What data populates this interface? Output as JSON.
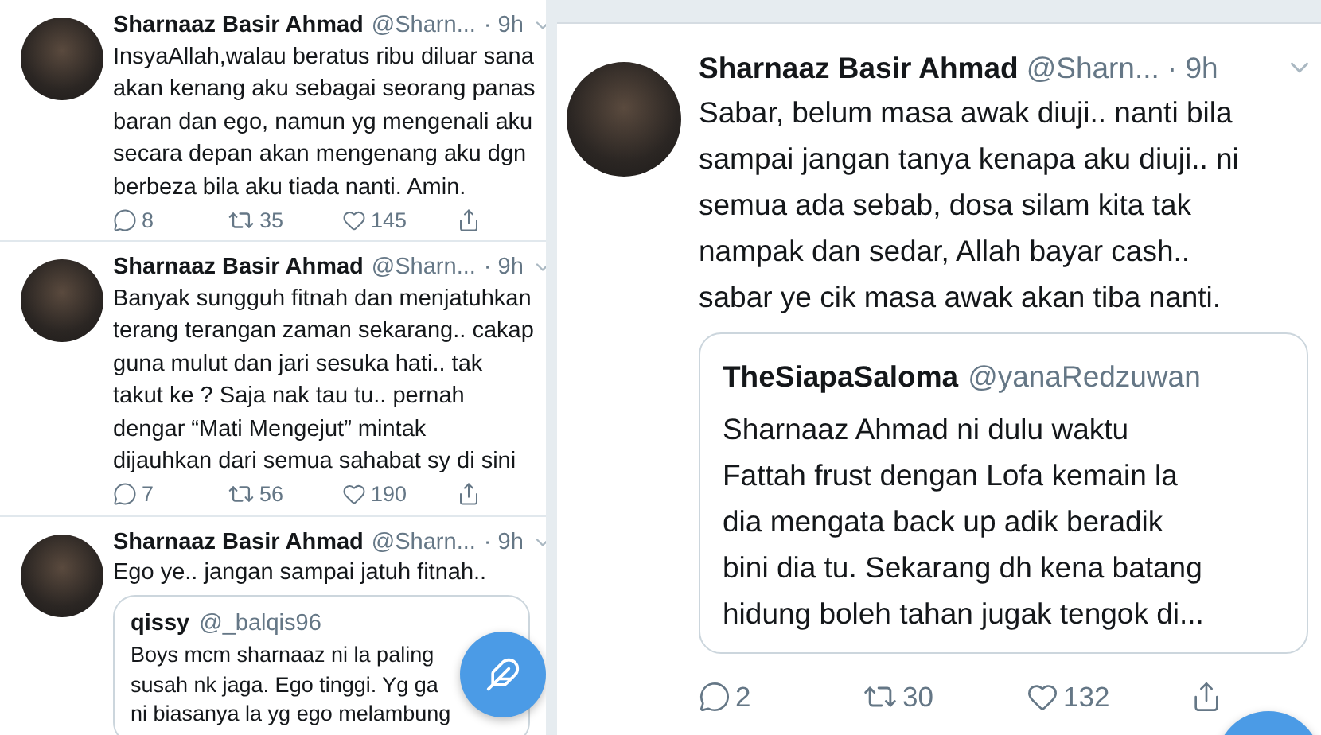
{
  "panels": [
    {
      "kind": "compact",
      "tweets": [
        {
          "name": "Sharnaaz Basir Ahmad",
          "handle": "@Sharn...",
          "time": "· 9h",
          "lines": [
            "InsyaAllah,walau beratus ribu diluar sana",
            "akan kenang aku sebagai seorang panas",
            "baran dan ego, namun yg mengenali aku",
            "secara depan akan mengenang aku dgn",
            "berbeza bila aku tiada nanti. Amin."
          ],
          "replies": "8",
          "retweets": "35",
          "likes": "145"
        },
        {
          "name": "Sharnaaz Basir Ahmad",
          "handle": "@Sharn...",
          "time": "· 9h",
          "lines": [
            "Banyak sungguh fitnah dan menjatuhkan",
            "terang terangan zaman sekarang.. cakap",
            "guna mulut dan jari sesuka hati.. tak",
            "takut ke ? Saja nak tau tu.. pernah",
            "dengar “Mati Mengejut” mintak",
            "dijauhkan dari semua sahabat sy di sini"
          ],
          "replies": "7",
          "retweets": "56",
          "likes": "190"
        },
        {
          "name": "Sharnaaz Basir Ahmad",
          "handle": "@Sharn...",
          "time": "· 9h",
          "lines": [
            "Ego ye.. jangan sampai jatuh fitnah.."
          ],
          "quote": {
            "name": "qissy",
            "handle": "@_balqis96",
            "lines": [
              "Boys mcm sharnaaz ni la paling",
              "susah nk jaga. Ego tinggi. Yg ga",
              "ni biasanya la yg ego melambung"
            ]
          }
        }
      ]
    },
    {
      "kind": "large",
      "tweets": [
        {
          "name": "Sharnaaz Basir Ahmad",
          "handle": "@Sharn...",
          "time": "· 9h",
          "lines": [
            "Sabar, belum masa awak diuji.. nanti bila",
            "sampai jangan tanya kenapa aku diuji.. ni",
            "semua ada sebab, dosa silam kita tak",
            "nampak dan sedar, Allah bayar cash..",
            "sabar ye cik masa awak akan tiba nanti."
          ],
          "quote": {
            "name": "TheSiapaSaloma",
            "handle": "@yanaRedzuwan",
            "lines": [
              "Sharnaaz Ahmad ni dulu waktu",
              "Fattah frust dengan Lofa kemain la",
              "dia mengata back up adik beradik",
              "bini dia tu. Sekarang dh kena batang",
              "hidung boleh tahan jugak tengok di..."
            ]
          },
          "replies": "2",
          "retweets": "30",
          "likes": "132"
        }
      ]
    }
  ]
}
